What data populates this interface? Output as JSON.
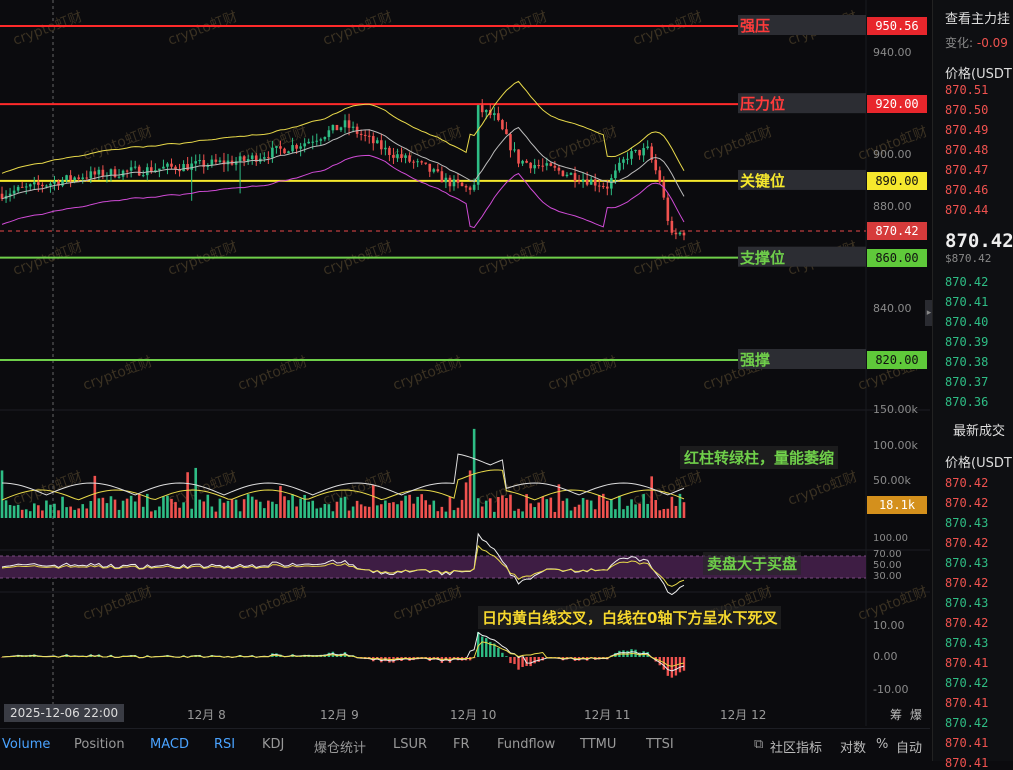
{
  "colors": {
    "bg": "#0b0b0e",
    "red": "#f0524f",
    "green": "#2ebd85",
    "yellow": "#f6d82d",
    "lime": "#6fcf4a",
    "purple": "#5a2a5e"
  },
  "levels": [
    {
      "label": "强压",
      "price": "950.56",
      "value": 950.56,
      "color": "#ff2a2a"
    },
    {
      "label": "压力位",
      "price": "920.00",
      "value": 920,
      "color": "#ff2a2a"
    },
    {
      "label": "关键位",
      "price": "890.00",
      "value": 890,
      "color": "#f6e82d"
    },
    {
      "label": "支撑位",
      "price": "860.00",
      "value": 860,
      "color": "#6fcf4a"
    },
    {
      "label": "强撑",
      "price": "820.00",
      "value": 820,
      "color": "#6fcf4a"
    }
  ],
  "current_price": {
    "price": "870.42",
    "value": 870.42
  },
  "y_ticks": [
    "940.00",
    "900.00",
    "880.00",
    "840.00"
  ],
  "y_ticks_values": [
    940,
    900,
    880,
    840
  ],
  "volume_ticks": [
    "150.00k",
    "100.00k",
    "50.00k"
  ],
  "volume_current": "18.1k",
  "rsi_ticks": [
    "100.00",
    "70.00",
    "50.00",
    "30.00"
  ],
  "macd_ticks": [
    "10.00",
    "0.00",
    "-10.00"
  ],
  "annotations": {
    "volume": "红柱转绿柱，量能萎缩",
    "rsi": "卖盘大于买盘",
    "macd": "日内黄白线交叉，白线在0轴下方呈水下死叉"
  },
  "x_labels": [
    "12月 8",
    "12月 9",
    "12月 10",
    "12月 11",
    "12月 12"
  ],
  "crosshair_date": "2025-12-06 22:00",
  "watermark": "crypto虹财",
  "bottom_tabs": [
    "Volume",
    "Position",
    "MACD",
    "RSI",
    "KDJ",
    "爆仓统计",
    "LSUR",
    "FR",
    "Fundflow",
    "TTMU",
    "TTSI"
  ],
  "bottom_right": {
    "community": "社区指标",
    "log": "对数",
    "pct": "%",
    "auto": "自动",
    "right1": "筹",
    "right2": "爆"
  },
  "right_panel": {
    "title": "查看主力挂",
    "change_label": "变化",
    "change_value": "-0.09",
    "price_header": "价格(USDT",
    "ask_prices": [
      "870.51",
      "870.50",
      "870.49",
      "870.48",
      "870.47",
      "870.46",
      "870.44"
    ],
    "last_price": "870.42",
    "last_usd": "$870.42",
    "bid_prices": [
      "870.42",
      "870.41",
      "870.40",
      "870.39",
      "870.38",
      "870.37",
      "870.36"
    ],
    "trades_title": "最新成交",
    "trades_header": "价格(USDT",
    "trades": [
      {
        "p": "870.42",
        "c": "red"
      },
      {
        "p": "870.42",
        "c": "red"
      },
      {
        "p": "870.43",
        "c": "grn"
      },
      {
        "p": "870.42",
        "c": "red"
      },
      {
        "p": "870.43",
        "c": "grn"
      },
      {
        "p": "870.42",
        "c": "red"
      },
      {
        "p": "870.43",
        "c": "grn"
      },
      {
        "p": "870.42",
        "c": "red"
      },
      {
        "p": "870.43",
        "c": "grn"
      },
      {
        "p": "870.41",
        "c": "red"
      },
      {
        "p": "870.42",
        "c": "grn"
      },
      {
        "p": "870.41",
        "c": "red"
      },
      {
        "p": "870.42",
        "c": "grn"
      },
      {
        "p": "870.41",
        "c": "red"
      },
      {
        "p": "870.41",
        "c": "red"
      }
    ]
  }
}
